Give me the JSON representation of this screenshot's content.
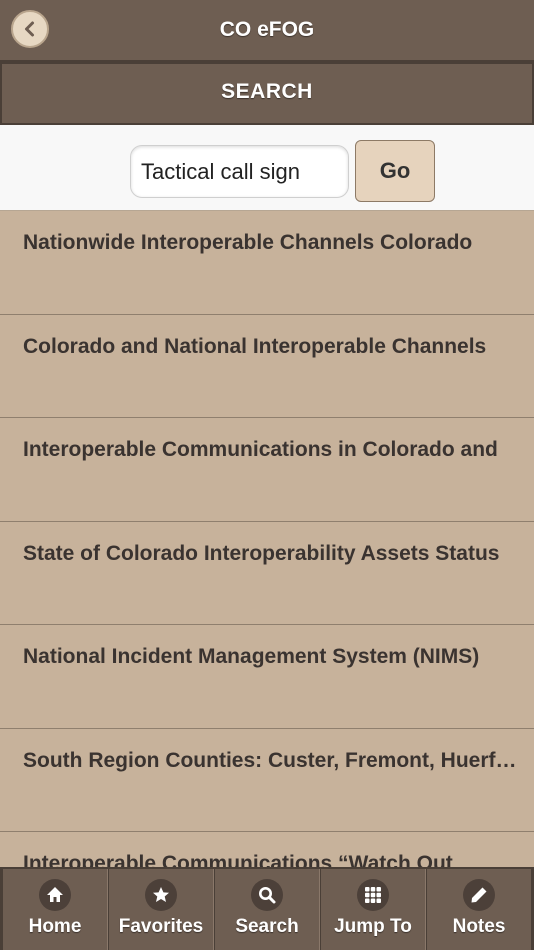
{
  "header": {
    "title": "CO eFOG",
    "back_icon": "chevron-left-icon"
  },
  "section": {
    "title": "SEARCH"
  },
  "search": {
    "value": "Tactical call sign",
    "go_label": "Go"
  },
  "results": [
    {
      "label": "Nationwide Interoperable Channels Colorado"
    },
    {
      "label": "Colorado and National Interoperable Channels"
    },
    {
      "label": "Interoperable Communications in Colorado and"
    },
    {
      "label": "State of Colorado Interoperability Assets Status"
    },
    {
      "label": "National Incident Management System (NIMS)"
    },
    {
      "label": "South Region Counties: Custer, Fremont, Huerfano"
    },
    {
      "label": "Interoperable Communications “Watch Out"
    }
  ],
  "tabbar": {
    "items": [
      {
        "label": "Home",
        "icon": "home-icon"
      },
      {
        "label": "Favorites",
        "icon": "star-icon"
      },
      {
        "label": "Search",
        "icon": "search-icon"
      },
      {
        "label": "Jump To",
        "icon": "grid-icon"
      },
      {
        "label": "Notes",
        "icon": "pencil-icon"
      }
    ]
  },
  "colors": {
    "bar": "#6e5e52",
    "list_bg": "#c7b29b",
    "go_bg": "#e6d3bd"
  }
}
